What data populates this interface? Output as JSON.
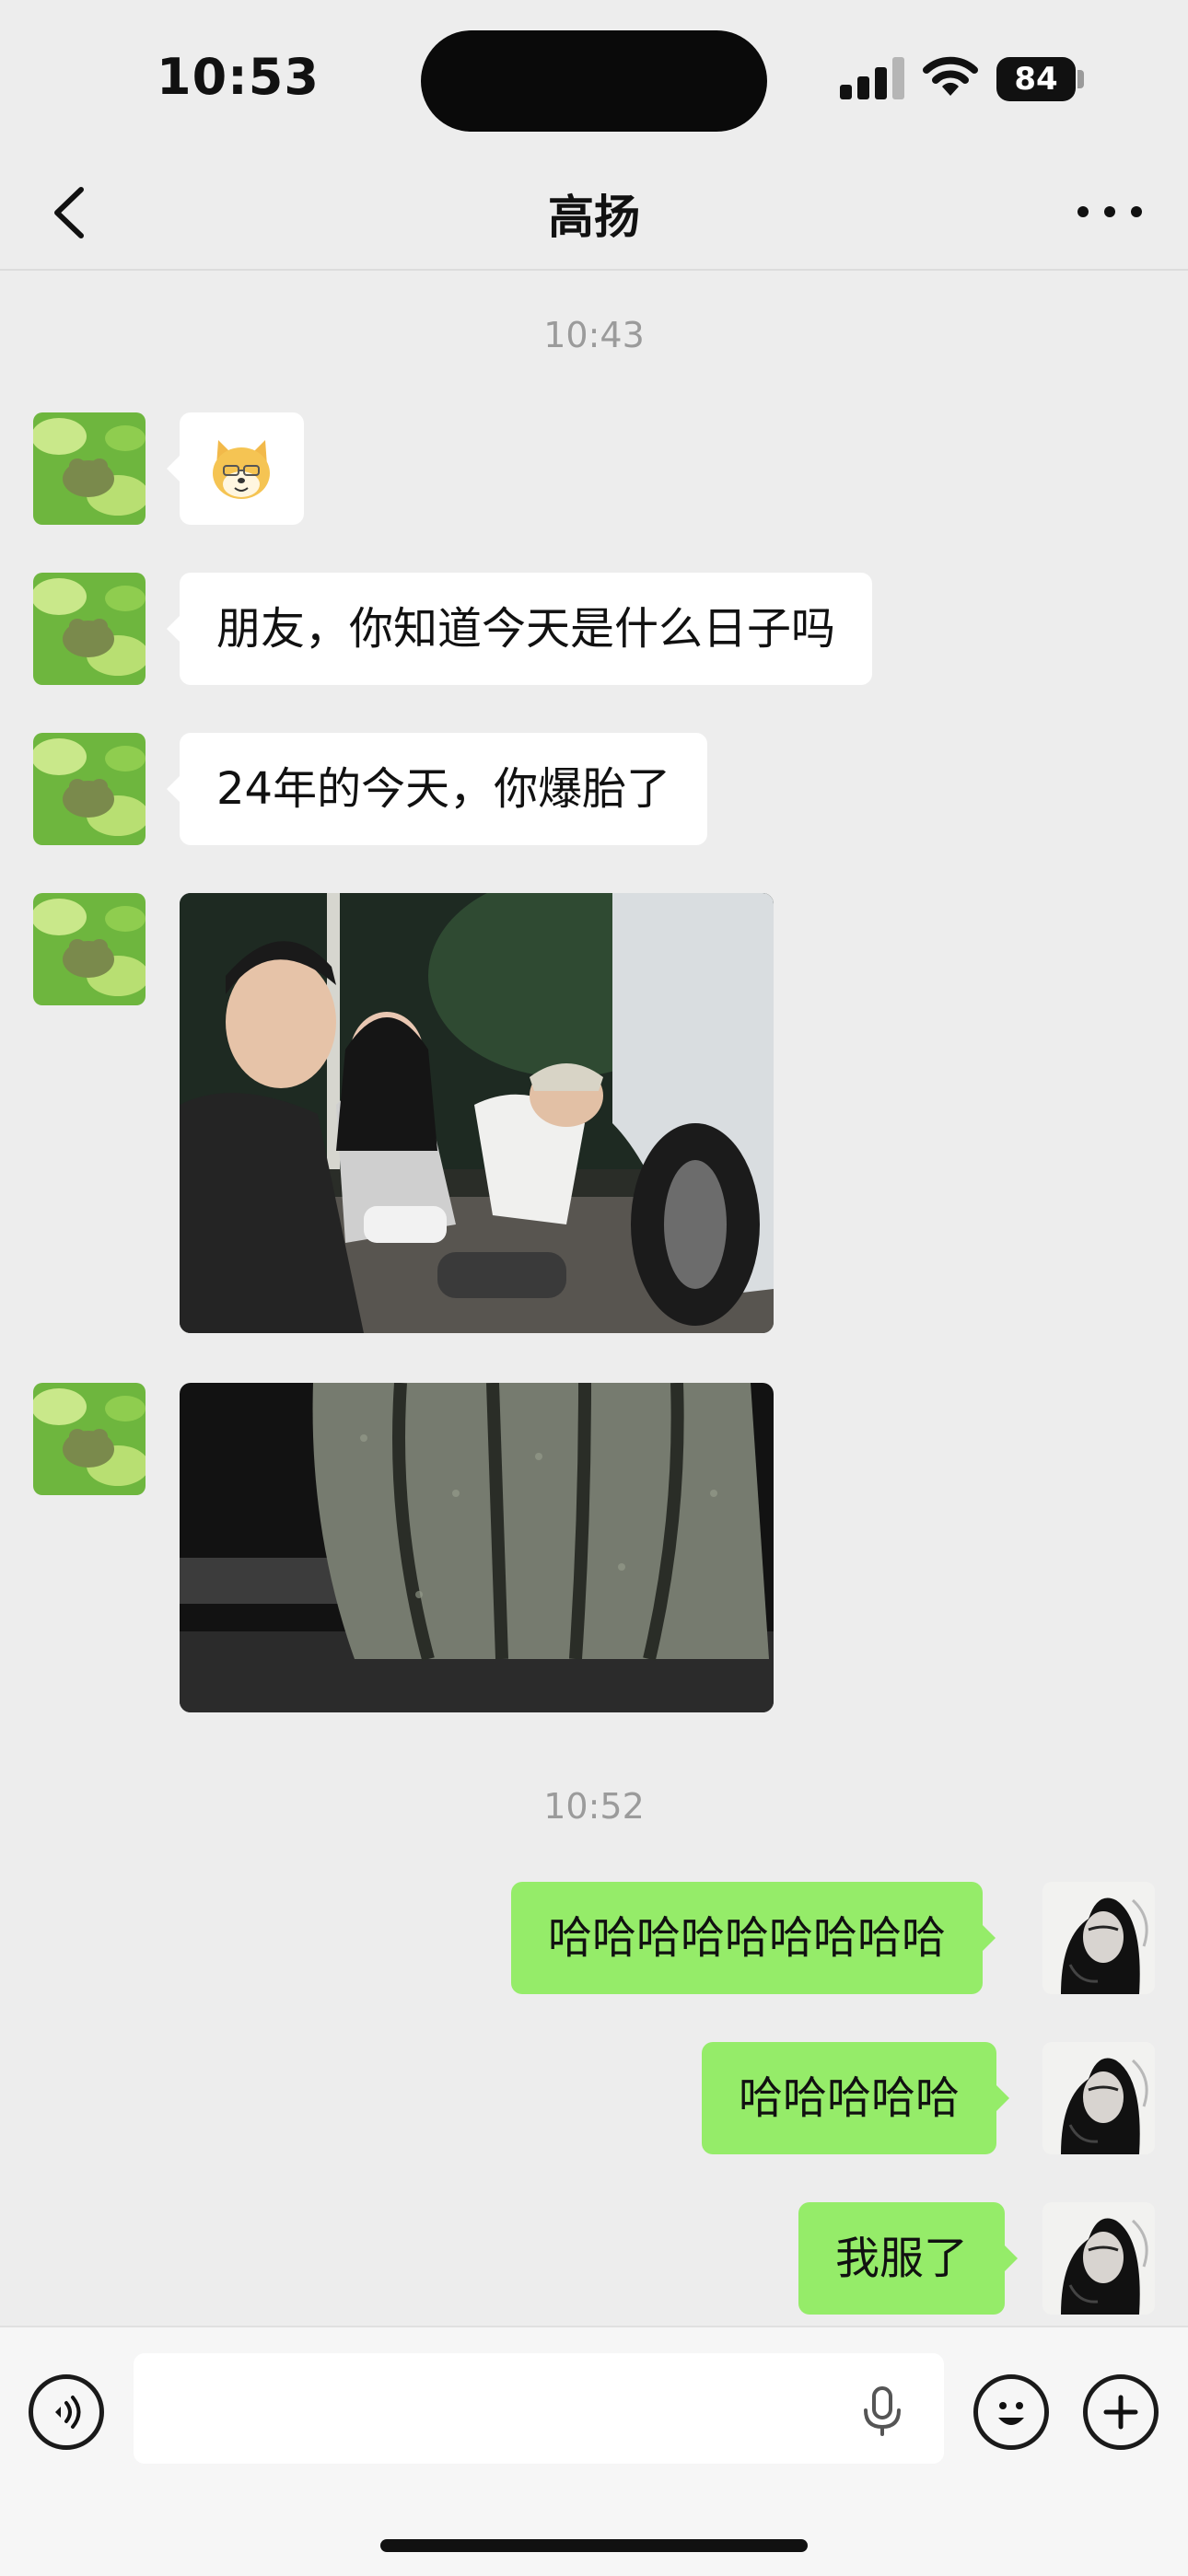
{
  "status_bar": {
    "time": "10:53",
    "battery": "84"
  },
  "header": {
    "title": "高扬"
  },
  "messages": {
    "ts1": "10:43",
    "m2": "朋友，你知道今天是什么日子吗",
    "m3": "24年的今天，你爆胎了",
    "ts2": "10:52",
    "r1": "哈哈哈哈哈哈哈哈哈",
    "r2": "哈哈哈哈哈",
    "r3": "我服了"
  },
  "input": {
    "placeholder": ""
  },
  "colors": {
    "sent_bubble": "#95ec69",
    "received_bubble": "#ffffff",
    "background": "#ededed"
  },
  "icons": [
    "back-chevron-icon",
    "more-icon",
    "voice-icon",
    "microphone-icon",
    "emoji-icon",
    "plus-icon"
  ]
}
